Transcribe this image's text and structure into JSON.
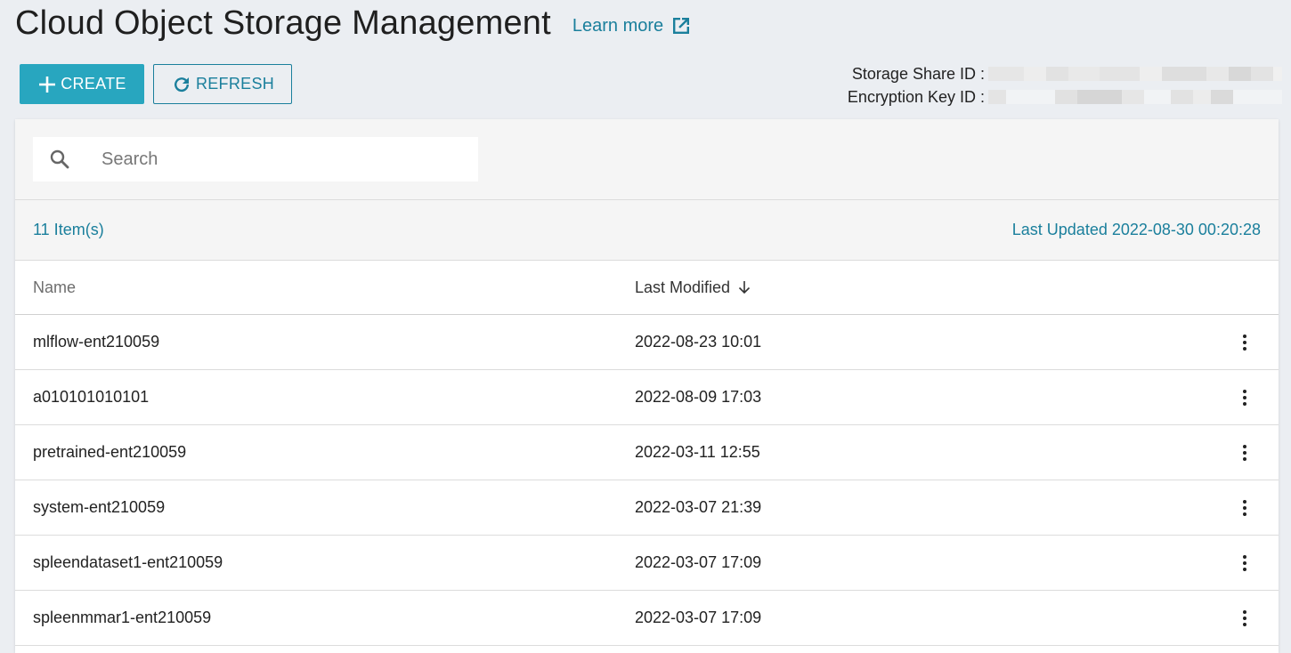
{
  "header": {
    "title": "Cloud Object Storage Management",
    "learn_more": "Learn more"
  },
  "toolbar": {
    "create_label": "CREATE",
    "refresh_label": "REFRESH"
  },
  "ids": {
    "storage_share_label": "Storage Share ID :",
    "encryption_key_label": "Encryption Key ID :"
  },
  "search": {
    "placeholder": "Search"
  },
  "summary": {
    "item_count": "11 Item(s)",
    "last_updated": "Last Updated 2022-08-30 00:20:28"
  },
  "table": {
    "columns": {
      "name": "Name",
      "last_modified": "Last Modified"
    },
    "rows": [
      {
        "name": "mlflow-ent210059",
        "modified": "2022-08-23 10:01"
      },
      {
        "name": "a010101010101",
        "modified": "2022-08-09 17:03"
      },
      {
        "name": "pretrained-ent210059",
        "modified": "2022-03-11 12:55"
      },
      {
        "name": "system-ent210059",
        "modified": "2022-03-07 21:39"
      },
      {
        "name": "spleendataset1-ent210059",
        "modified": "2022-03-07 17:09"
      },
      {
        "name": "spleenmmar1-ent210059",
        "modified": "2022-03-07 17:09"
      }
    ]
  },
  "colors": {
    "accent": "#28a6bf",
    "link": "#1a7f9c"
  },
  "icons": {
    "create": "plus-icon",
    "refresh": "refresh-icon",
    "learn_more": "external-link-icon",
    "search": "search-icon",
    "sort": "arrow-down-icon",
    "row_actions": "kebab-menu-icon"
  }
}
